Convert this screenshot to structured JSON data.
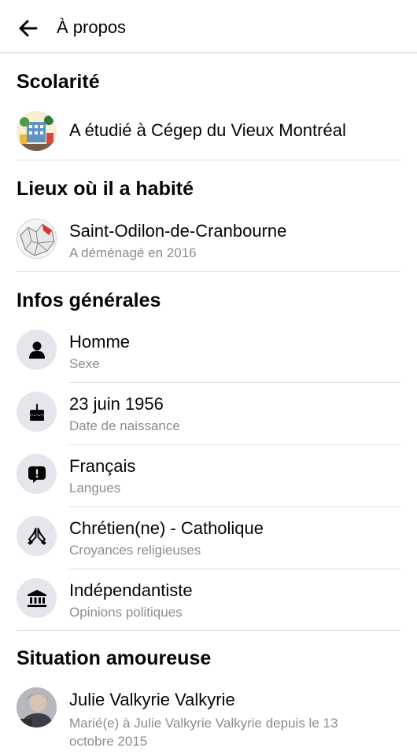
{
  "header": {
    "title": "À propos"
  },
  "education": {
    "title": "Scolarité",
    "item": {
      "text": "A étudié à Cégep du Vieux Montréal"
    }
  },
  "places": {
    "title": "Lieux où il a habité",
    "item": {
      "text": "Saint-Odilon-de-Cranbourne",
      "detail": "A déménagé en 2016"
    }
  },
  "general": {
    "title": "Infos générales",
    "items": [
      {
        "value": "Homme",
        "label": "Sexe",
        "icon": "person-icon"
      },
      {
        "value": "23 juin 1956",
        "label": "Date de naissance",
        "icon": "birthday-cake-icon"
      },
      {
        "value": "Français",
        "label": "Langues",
        "icon": "speech-bubble-icon"
      },
      {
        "value": "Chrétien(ne) - Catholique",
        "label": "Croyances religieuses",
        "icon": "praying-hands-icon"
      },
      {
        "value": "Indépendantiste",
        "label": "Opinions politiques",
        "icon": "institution-icon"
      }
    ]
  },
  "relationship": {
    "title": "Situation amoureuse",
    "item": {
      "name": "Julie Valkyrie Valkyrie",
      "detail": "Marié(e) à Julie Valkyrie Valkyrie depuis le 13 octobre 2015"
    }
  }
}
